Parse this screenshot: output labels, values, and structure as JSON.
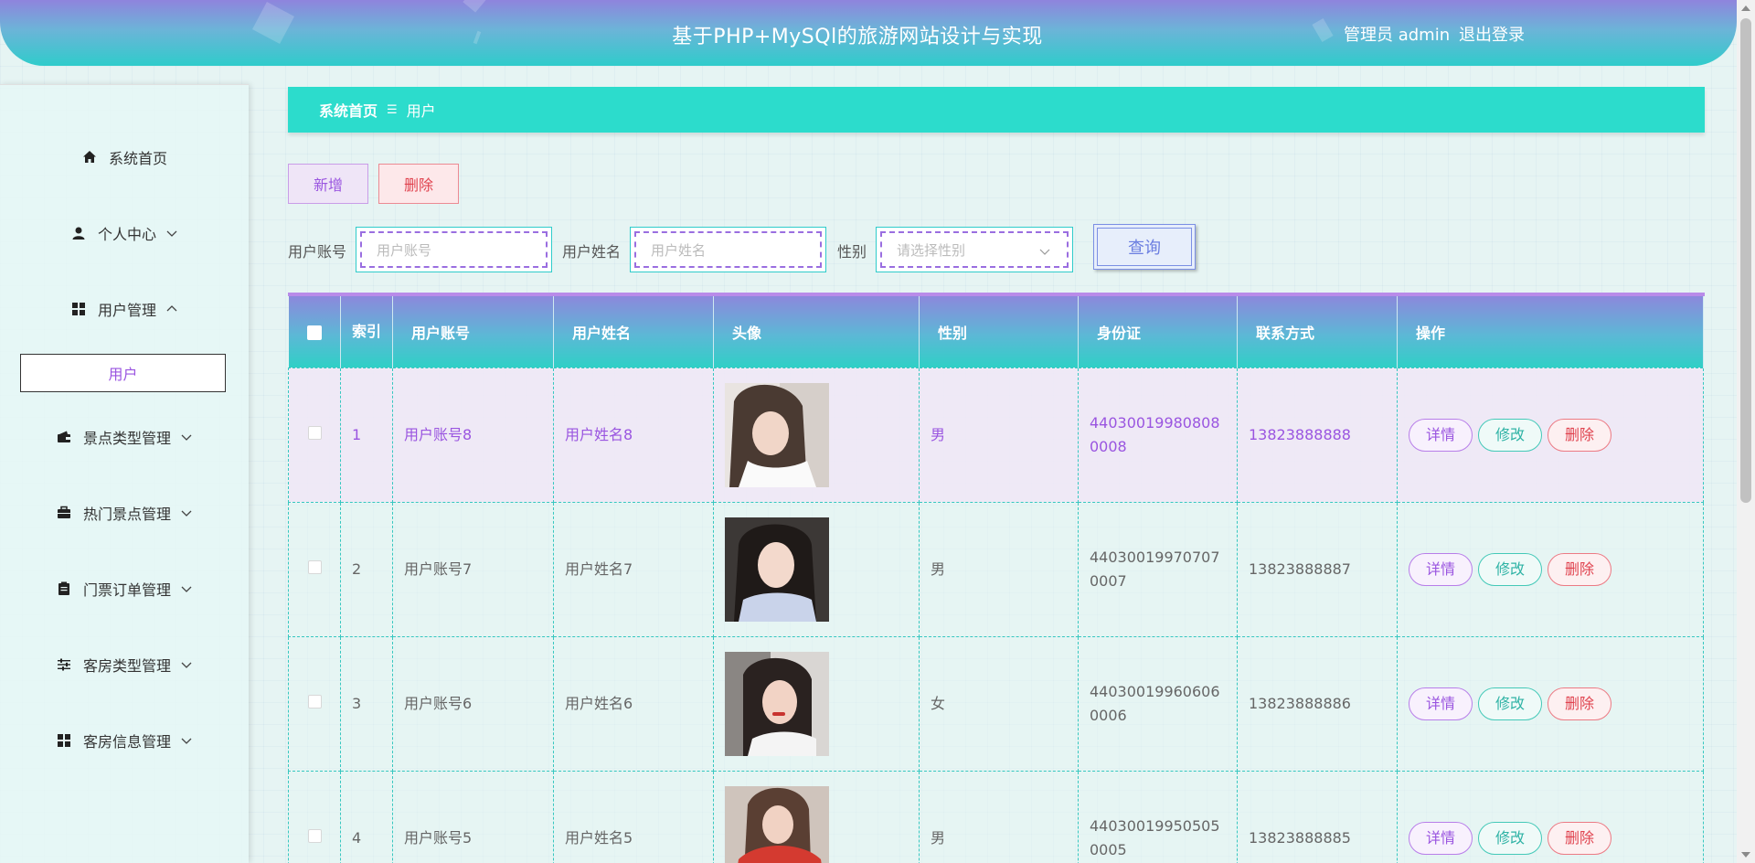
{
  "header": {
    "title": "基于PHP+MySQl的旅游网站设计与实现",
    "admin": "管理员 admin",
    "logout": "退出登录"
  },
  "sidebar": {
    "items": [
      {
        "label": "系统首页",
        "icon": "home-icon"
      },
      {
        "label": "个人中心",
        "icon": "user-icon"
      },
      {
        "label": "用户管理",
        "icon": "grid-icon"
      },
      {
        "label": "景点类型管理",
        "icon": "wallet-icon"
      },
      {
        "label": "热门景点管理",
        "icon": "briefcase-icon"
      },
      {
        "label": "门票订单管理",
        "icon": "clipboard-icon"
      },
      {
        "label": "客房类型管理",
        "icon": "sliders-icon"
      },
      {
        "label": "客房信息管理",
        "icon": "grid-icon"
      }
    ],
    "sub_item": "用户"
  },
  "breadcrumb": {
    "home": "系统首页",
    "separator": "☰",
    "current": "用户"
  },
  "actions": {
    "add": "新增",
    "delete": "删除"
  },
  "search": {
    "account_label": "用户账号",
    "account_placeholder": "用户账号",
    "name_label": "用户姓名",
    "name_placeholder": "用户姓名",
    "gender_label": "性别",
    "gender_placeholder": "请选择性别",
    "query": "查询"
  },
  "table": {
    "headers": {
      "index": "索引",
      "account": "用户账号",
      "name": "用户姓名",
      "avatar": "头像",
      "gender": "性别",
      "idcard": "身份证",
      "phone": "联系方式",
      "ops": "操作"
    },
    "rows": [
      {
        "index": "1",
        "account": "用户账号8",
        "name": "用户姓名8",
        "gender": "男",
        "idcard": "440300199808080008",
        "phone": "13823888888"
      },
      {
        "index": "2",
        "account": "用户账号7",
        "name": "用户姓名7",
        "gender": "男",
        "idcard": "440300199707070007",
        "phone": "13823888887"
      },
      {
        "index": "3",
        "account": "用户账号6",
        "name": "用户姓名6",
        "gender": "女",
        "idcard": "440300199606060006",
        "phone": "13823888886"
      },
      {
        "index": "4",
        "account": "用户账号5",
        "name": "用户姓名5",
        "gender": "男",
        "idcard": "440300199505050005",
        "phone": "13823888885"
      }
    ],
    "ops": {
      "detail": "详情",
      "edit": "修改",
      "delete": "删除"
    }
  },
  "colors": {
    "accent_teal": "#2cdccc",
    "accent_purple": "#9a55e0",
    "danger": "#e0434f"
  }
}
